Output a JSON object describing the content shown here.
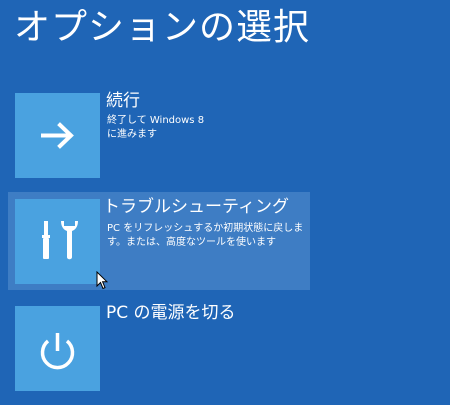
{
  "page": {
    "title": "オプションの選択"
  },
  "options": [
    {
      "title": "続行",
      "description": "終了して Windows 8\nに進みます",
      "icon": "arrow-right-icon"
    },
    {
      "title": "トラブルシューティング",
      "description": "PC をリフレッシュするか初期状態に戻しま\nす。または、高度なツールを使います",
      "icon": "wrench-screwdriver-icon"
    },
    {
      "title": "PC の電源を切る",
      "description": "",
      "icon": "power-icon"
    }
  ],
  "colors": {
    "background": "#1f65b6",
    "tile": "#4aa2e0",
    "highlight": "#3e7dc4",
    "text": "#ffffff"
  }
}
